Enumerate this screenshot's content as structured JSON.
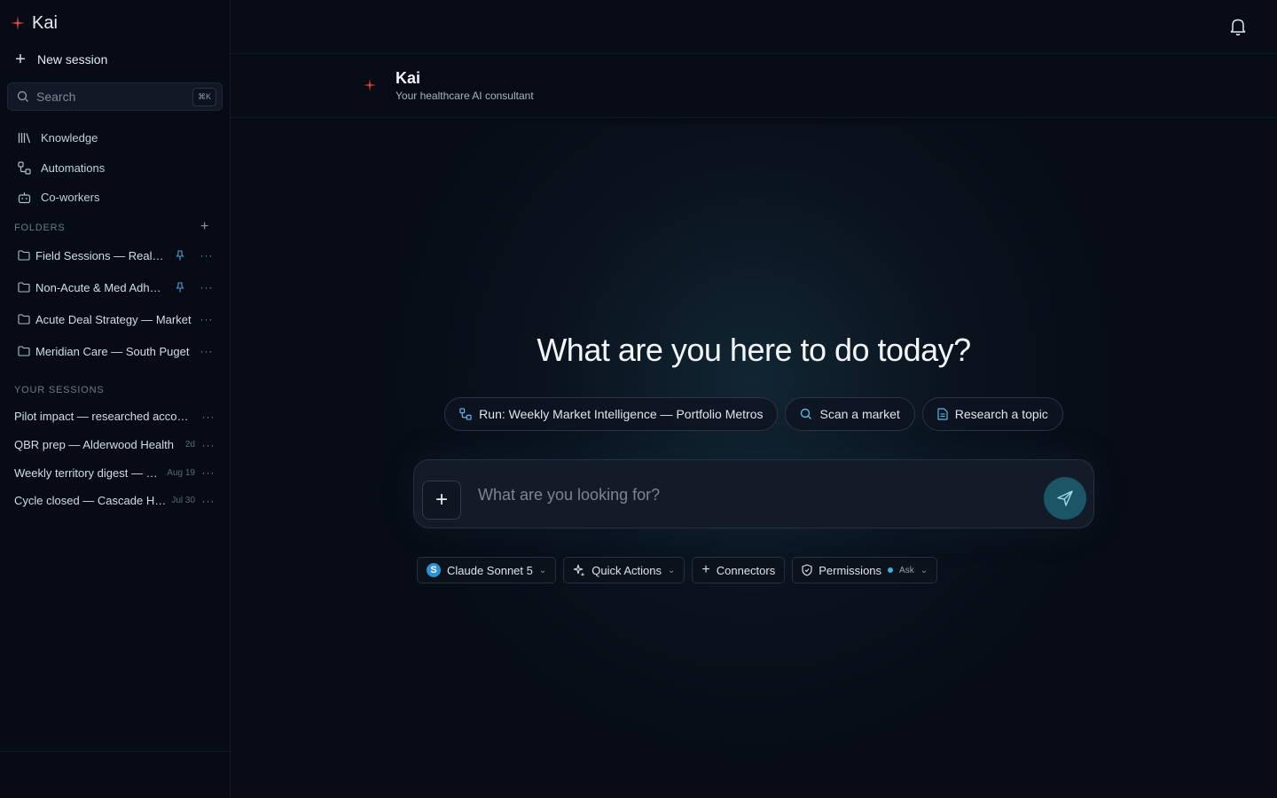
{
  "app": {
    "name": "Kai"
  },
  "sidebar": {
    "new_session": "New session",
    "search": {
      "placeholder": "Search",
      "shortcut": "⌘K"
    },
    "nav": [
      {
        "label": "Knowledge",
        "icon": "library-icon"
      },
      {
        "label": "Automations",
        "icon": "workflow-icon"
      },
      {
        "label": "Co-workers",
        "icon": "bot-icon"
      }
    ],
    "folders_label": "FOLDERS",
    "folders": [
      {
        "name": "Field Sessions — Real Estate",
        "pinned": true
      },
      {
        "name": "Non-Acute & Med Adherence",
        "pinned": true
      },
      {
        "name": "Acute Deal Strategy — Market",
        "pinned": false
      },
      {
        "name": "Meridian Care — South Puget",
        "pinned": false
      }
    ],
    "sessions_label": "YOUR SESSIONS",
    "sessions": [
      {
        "name": "Pilot impact — researched accounts",
        "date": ""
      },
      {
        "name": "QBR prep — Alderwood Health",
        "date": "2d"
      },
      {
        "name": "Weekly territory digest — Seattle",
        "date": "Aug 19"
      },
      {
        "name": "Cycle closed — Cascade Health",
        "date": "Jul 30"
      }
    ]
  },
  "agent": {
    "name": "Kai",
    "subtitle": "Your healthcare AI consultant"
  },
  "main": {
    "hero": "What are you here to do today?",
    "chips": [
      {
        "label": "Run: Weekly Market Intelligence — Portfolio Metros",
        "icon": "workflow-icon"
      },
      {
        "label": "Scan a market",
        "icon": "search-icon"
      },
      {
        "label": "Research a topic",
        "icon": "document-icon"
      }
    ],
    "composer": {
      "placeholder": "What are you looking for?"
    },
    "tools": {
      "model": "Claude Sonnet 5",
      "model_badge": "S",
      "quick_actions": "Quick Actions",
      "connectors": "Connectors",
      "permissions": "Permissions",
      "permissions_mode": "Ask"
    }
  },
  "colors": {
    "accent": "#e8453c",
    "send": "#1b5566",
    "badge": "#2d8fd6"
  }
}
